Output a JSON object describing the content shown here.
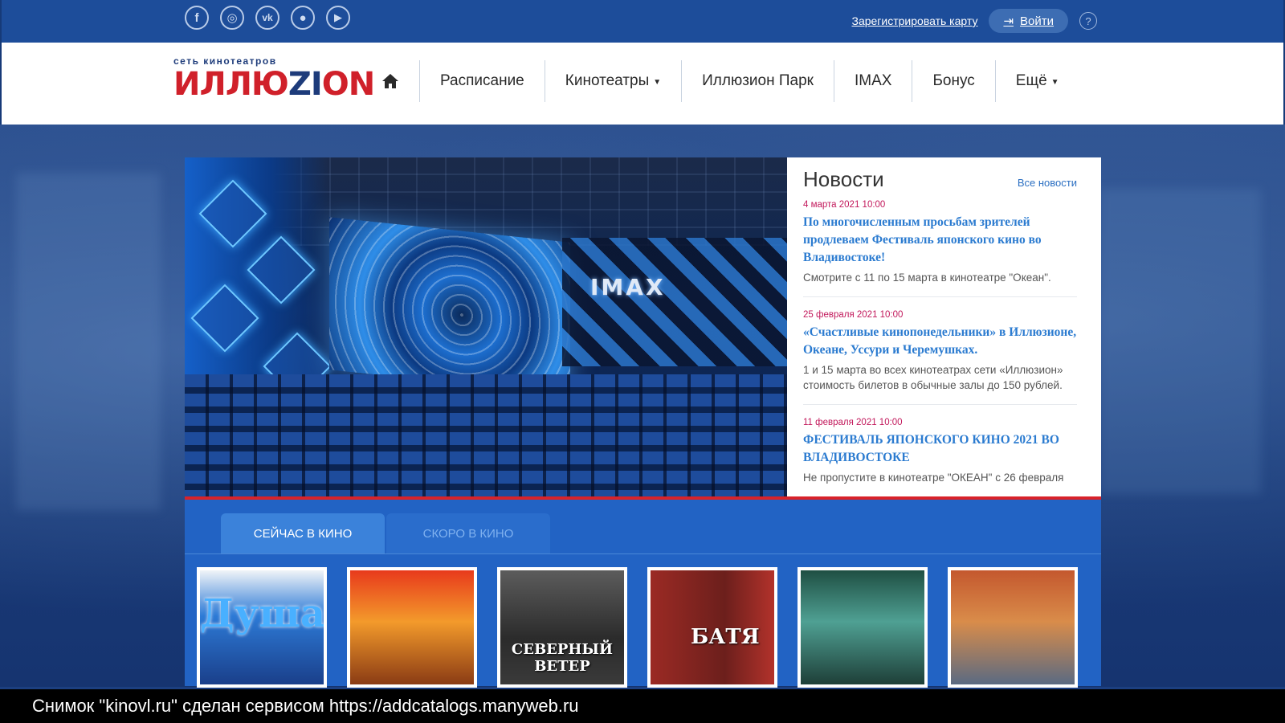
{
  "topbar": {
    "social": [
      {
        "name": "facebook-icon",
        "glyph": "f"
      },
      {
        "name": "instagram-icon",
        "glyph": "◎"
      },
      {
        "name": "vk-icon",
        "glyph": "vk"
      },
      {
        "name": "apple-icon",
        "glyph": "●"
      },
      {
        "name": "google-play-icon",
        "glyph": "▶"
      }
    ],
    "register_link": "Зарегистрировать карту",
    "login_label": "Войти",
    "help_glyph": "?"
  },
  "header": {
    "logo_small": "сеть кинотеатров",
    "logo_main_a": "ИЛЛЮ",
    "logo_main_b": "ZI",
    "logo_main_c": "ON",
    "nav": {
      "schedule": "Расписание",
      "cinemas": "Кинотеатры",
      "park": "Иллюзион Парк",
      "imax": "IMAX",
      "bonus": "Бонус",
      "more": "Ещё"
    }
  },
  "hero": {
    "imax_sign": "IMAX"
  },
  "news": {
    "title": "Новости",
    "all_link": "Все новости",
    "items": [
      {
        "date": "4 марта 2021 10:00",
        "headline": "По многочисленным просьбам зрителей продлеваем Фестиваль японского кино во Владивостоке!",
        "text": "Смотрите с 11 по 15 марта в кинотеатре \"Океан\"."
      },
      {
        "date": "25 февраля 2021 10:00",
        "headline": "«Счастливые кинопонедельники» в Иллюзионе, Океане, Уссури и Черемушках.",
        "text": "1 и 15 марта во всех кинотеатрах сети «Иллюзион» стоимость билетов в обычные залы до 150 рублей."
      },
      {
        "date": "11 февраля 2021 10:00",
        "headline": "ФЕСТИВАЛЬ ЯПОНСКОГО КИНО 2021 ВО ВЛАДИВОСТОКЕ",
        "text": "Не пропустите в кинотеатре \"ОКЕАН\" с 26 февраля"
      }
    ]
  },
  "films": {
    "tab_now": "СЕЙЧАС В КИНО",
    "tab_soon": "СКОРО В КИНО",
    "posters": [
      "Душа",
      "",
      "СЕВЕРНЫЙ ВЕТЕР",
      "БАТЯ",
      "",
      ""
    ]
  },
  "caption": "Снимок \"kinovl.ru\" сделан сервисом https://addcatalogs.manyweb.ru"
}
